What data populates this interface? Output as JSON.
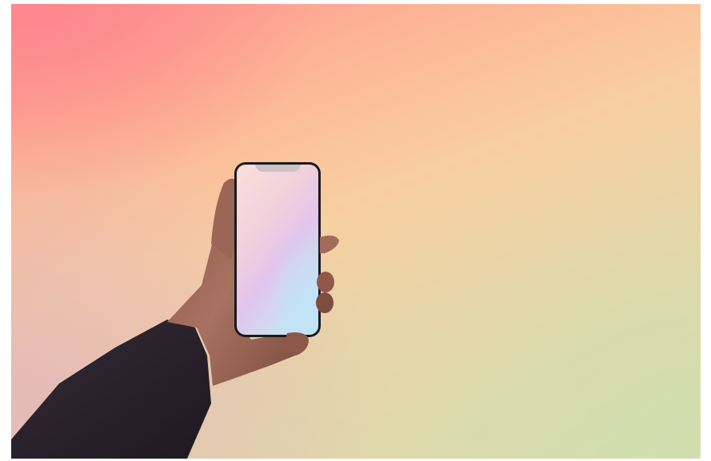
{
  "scene": {
    "description_label": "",
    "colors": {
      "bg_top_left": "#fd8f91",
      "bg_center": "#f9cea0",
      "bg_bottom_right": "#d5dcae",
      "bg_bottom_left": "#e2b5ba",
      "sleeve": "#2b222c",
      "skin": "#a06a58",
      "phone_bezel": "#1a1a1e",
      "screen_top": "#fbdede",
      "screen_mid": "#e3c4ea",
      "screen_bottom": "#c9e2f4"
    },
    "icons": [
      "hand-holding-phone",
      "smartphone-blank-screen"
    ]
  }
}
